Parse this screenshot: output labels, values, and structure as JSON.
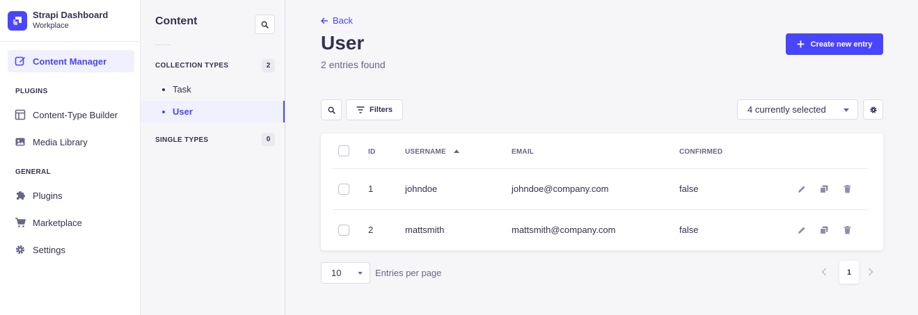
{
  "app": {
    "title": "Strapi Dashboard",
    "workspace": "Workplace",
    "accent": "#4945ff"
  },
  "leftnav": {
    "active_item": "Content Manager",
    "plugins_label": "PLUGINS",
    "plugins": [
      "Content-Type Builder",
      "Media Library"
    ],
    "general_label": "GENERAL",
    "general": [
      "Plugins",
      "Marketplace",
      "Settings"
    ]
  },
  "subnav": {
    "title": "Content",
    "collection_label": "COLLECTION TYPES",
    "collection_count": "2",
    "collection_items": [
      "Task",
      "User"
    ],
    "active_item": "User",
    "single_label": "SINGLE TYPES",
    "single_count": "0"
  },
  "main": {
    "back_label": "Back",
    "title": "User",
    "subtitle": "2 entries found",
    "create_label": "Create new entry",
    "filters_label": "Filters",
    "columns_select": "4 currently selected",
    "table": {
      "headers": [
        "ID",
        "USERNAME",
        "EMAIL",
        "CONFIRMED"
      ],
      "sorted_column": "USERNAME",
      "rows": [
        {
          "id": "1",
          "username": "johndoe",
          "email": "johndoe@company.com",
          "confirmed": "false"
        },
        {
          "id": "2",
          "username": "mattsmith",
          "email": "mattsmith@company.com",
          "confirmed": "false"
        }
      ]
    },
    "per_page_value": "10",
    "per_page_label": "Entries per page",
    "current_page": "1"
  }
}
